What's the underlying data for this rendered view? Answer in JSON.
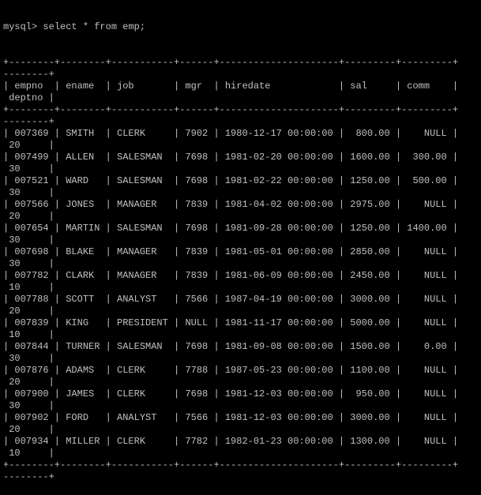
{
  "prompt": "mysql> ",
  "command": "select * from emp;",
  "table": {
    "columns": [
      "empno",
      "ename",
      "job",
      "mgr",
      "hiredate",
      "sal",
      "comm",
      "deptno"
    ],
    "rows": [
      [
        "007369",
        "SMITH",
        "CLERK",
        "7902",
        "1980-12-17 00:00:00",
        "800.00",
        "NULL",
        "20"
      ],
      [
        "007499",
        "ALLEN",
        "SALESMAN",
        "7698",
        "1981-02-20 00:00:00",
        "1600.00",
        "300.00",
        "30"
      ],
      [
        "007521",
        "WARD",
        "SALESMAN",
        "7698",
        "1981-02-22 00:00:00",
        "1250.00",
        "500.00",
        "30"
      ],
      [
        "007566",
        "JONES",
        "MANAGER",
        "7839",
        "1981-04-02 00:00:00",
        "2975.00",
        "NULL",
        "20"
      ],
      [
        "007654",
        "MARTIN",
        "SALESMAN",
        "7698",
        "1981-09-28 00:00:00",
        "1250.00",
        "1400.00",
        "30"
      ],
      [
        "007698",
        "BLAKE",
        "MANAGER",
        "7839",
        "1981-05-01 00:00:00",
        "2850.00",
        "NULL",
        "30"
      ],
      [
        "007782",
        "CLARK",
        "MANAGER",
        "7839",
        "1981-06-09 00:00:00",
        "2450.00",
        "NULL",
        "10"
      ],
      [
        "007788",
        "SCOTT",
        "ANALYST",
        "7566",
        "1987-04-19 00:00:00",
        "3000.00",
        "NULL",
        "20"
      ],
      [
        "007839",
        "KING",
        "PRESIDENT",
        "NULL",
        "1981-11-17 00:00:00",
        "5000.00",
        "NULL",
        "10"
      ],
      [
        "007844",
        "TURNER",
        "SALESMAN",
        "7698",
        "1981-09-08 00:00:00",
        "1500.00",
        "0.00",
        "30"
      ],
      [
        "007876",
        "ADAMS",
        "CLERK",
        "7788",
        "1987-05-23 00:00:00",
        "1100.00",
        "NULL",
        "20"
      ],
      [
        "007900",
        "JAMES",
        "CLERK",
        "7698",
        "1981-12-03 00:00:00",
        "950.00",
        "NULL",
        "30"
      ],
      [
        "007902",
        "FORD",
        "ANALYST",
        "7566",
        "1981-12-03 00:00:00",
        "3000.00",
        "NULL",
        "20"
      ],
      [
        "007934",
        "MILLER",
        "CLERK",
        "7782",
        "1982-01-23 00:00:00",
        "1300.00",
        "NULL",
        "10"
      ]
    ]
  },
  "colors": {
    "background": "#000000",
    "text": "#c0c0c0"
  }
}
